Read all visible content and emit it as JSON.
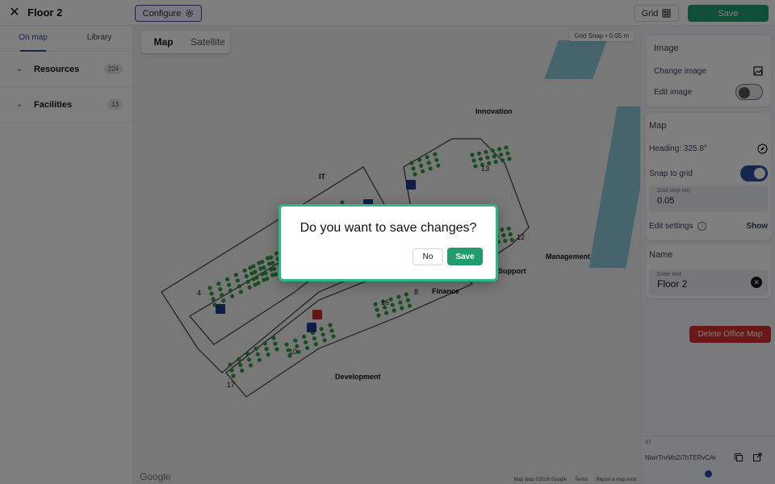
{
  "header": {
    "title": "Floor 2",
    "configure_label": "Configure",
    "grid_label": "Grid",
    "save_label": "Save"
  },
  "left_panel": {
    "tabs": [
      "On map",
      "Library"
    ],
    "active_tab": "On map",
    "sections": [
      {
        "label": "Resources",
        "count": "224"
      },
      {
        "label": "Facilities",
        "count": "13"
      }
    ]
  },
  "map": {
    "types": [
      "Map",
      "Satellite"
    ],
    "active_type": "Map",
    "snap_badge": "Grid Snap • 0.05 m",
    "zone_labels": [
      "Innovation",
      "IT",
      "Management",
      "Support",
      "Finance",
      "Development"
    ],
    "seat_numbers": [
      "13",
      "12",
      "4",
      "8",
      "16",
      "10",
      "17"
    ],
    "google_label": "Google",
    "footer": [
      "Map data ©2026 Google",
      "Terms",
      "Report a map error"
    ]
  },
  "right_panel": {
    "image": {
      "title": "Image",
      "change_image": "Change image",
      "edit_image": "Edit image",
      "edit_image_on": false
    },
    "map": {
      "title": "Map",
      "heading": "Heading: 325.8°",
      "snap_to_grid": "Snap to grid",
      "snap_on": true,
      "grid_step_label": "Grid step (m)",
      "grid_step_value": "0.05",
      "edit_settings": "Edit settings",
      "show_label": "Show"
    },
    "name": {
      "title": "Name",
      "field_label": "Enter text",
      "value": "Floor 2"
    },
    "delete_label": "Delete Office Map",
    "id_label": "ID",
    "id_value": "NiwrTnrMo2i7hTERvCAr"
  },
  "dialog": {
    "title": "Do you want to save changes?",
    "no_label": "No",
    "save_label": "Save"
  },
  "colors": {
    "primary": "#2a4ea0",
    "save_green": "#1f9d6e",
    "dialog_border": "#2bb58a",
    "delete_red": "#d32f2f",
    "seat_green": "#2e9d3e",
    "water": "#8ac8d6"
  }
}
